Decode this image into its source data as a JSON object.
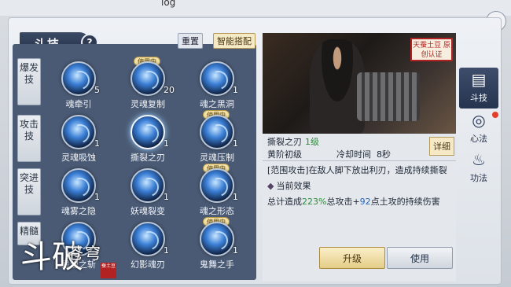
{
  "top": {
    "log": "log"
  },
  "panel": {
    "title": "斗技",
    "help": "?",
    "reset": "重置",
    "smart_match": "智能搭配",
    "close": "×"
  },
  "categories": [
    {
      "label": "爆发技"
    },
    {
      "label": "攻击技"
    },
    {
      "label": "突进技"
    },
    {
      "label": "精髓"
    }
  ],
  "skills": [
    {
      "name": "魂牵引",
      "level": "5",
      "tag": ""
    },
    {
      "name": "灵魂复制",
      "level": "20",
      "tag": "使用中"
    },
    {
      "name": "魂之黑洞",
      "level": "1",
      "tag": ""
    },
    {
      "name": "灵魂吸蚀",
      "level": "1",
      "tag": ""
    },
    {
      "name": "撕裂之刃",
      "level": "1",
      "tag": ""
    },
    {
      "name": "灵魂压制",
      "level": "1",
      "tag": "使用中"
    },
    {
      "name": "魂雾之隐",
      "level": "1",
      "tag": ""
    },
    {
      "name": "妖魂裂变",
      "level": "1",
      "tag": ""
    },
    {
      "name": "魂之形态",
      "level": "1",
      "tag": "使用中"
    },
    {
      "name": "星魂之斩",
      "level": "1",
      "tag": ""
    },
    {
      "name": "幻影魂刃",
      "level": "1",
      "tag": ""
    },
    {
      "name": "鬼舞之手",
      "level": "1",
      "tag": "使用中"
    }
  ],
  "detail": {
    "seal_text": "天蚕土豆 原创认证",
    "skill_name": "撕裂之刃",
    "skill_level": "1级",
    "rank": "黄阶初级",
    "cooldown_label": "冷却时间",
    "cooldown_value": "8秒",
    "detail_button": "详细",
    "description": "[范围攻击]在敌人脚下放出利刃，造成持续撕裂",
    "effect_header": "当前效果",
    "effect_prefix": "总计造成",
    "effect_pct": "223%",
    "effect_mid": "总攻击+",
    "effect_num": "92",
    "effect_suffix": "点土攻的持续伤害",
    "upgrade": "升级",
    "use": "使用"
  },
  "side_tabs": [
    {
      "label": "斗技",
      "icon": "book-icon",
      "active": true
    },
    {
      "label": "心法",
      "icon": "spirit-icon",
      "active": false
    },
    {
      "label": "功法",
      "icon": "flame-icon",
      "active": false
    }
  ],
  "watermark": {
    "big": "斗破",
    "small": "苍穹",
    "seal": "蚕土豆"
  },
  "colors": {
    "accent_green": "#2e8a3a",
    "accent_blue": "#2667b8",
    "tag_gold": "#f3e3a8",
    "active_tab": "#26344f"
  }
}
